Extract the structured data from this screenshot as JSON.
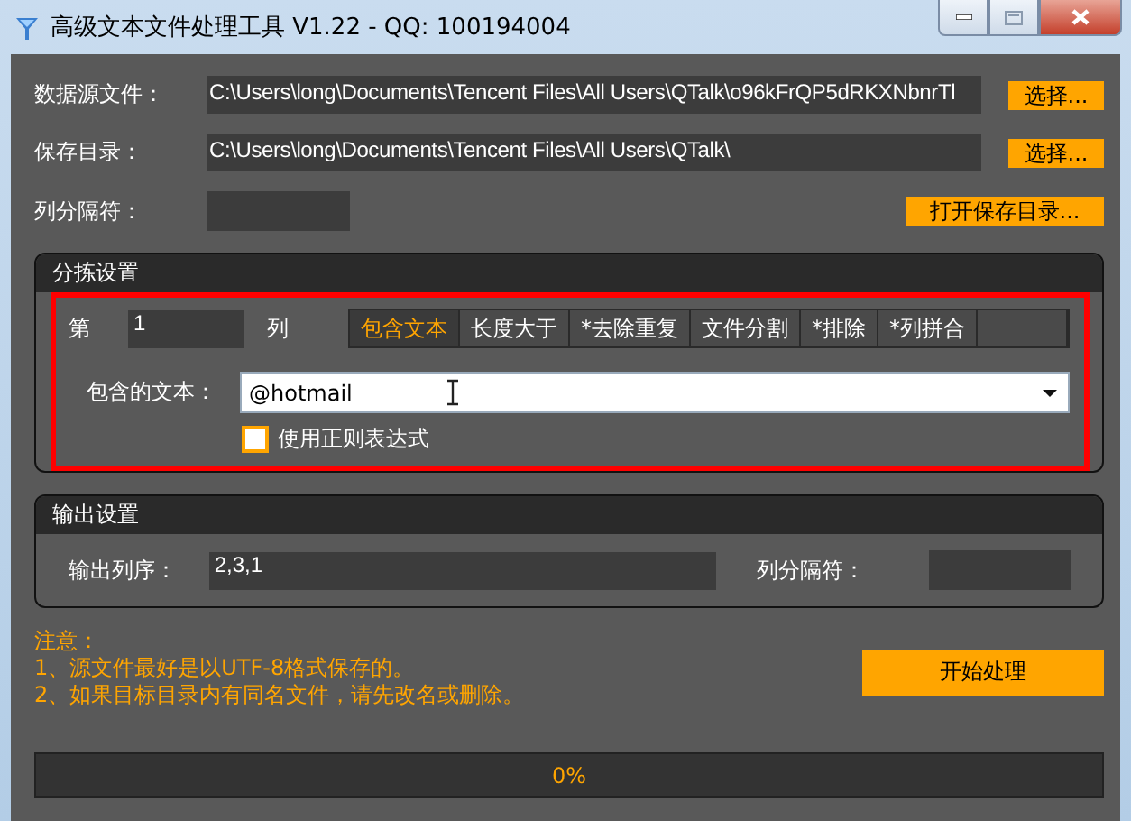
{
  "window": {
    "title": "高级文本文件处理工具 V1.22 - QQ: 100194004"
  },
  "source_file": {
    "label": "数据源文件：",
    "value": "C:\\Users\\long\\Documents\\Tencent Files\\All Users\\QTalk\\o96kFrQP5dRKXNbnrTl",
    "button": "选择..."
  },
  "save_dir": {
    "label": "保存目录：",
    "value": "C:\\Users\\long\\Documents\\Tencent Files\\All Users\\QTalk\\",
    "button": "选择..."
  },
  "separator": {
    "label": "列分隔符：",
    "button": "打开保存目录..."
  },
  "sort_group": {
    "title": "分拣设置",
    "highlighted": true,
    "column_prefix": "第",
    "column_value": "1",
    "column_suffix": "列",
    "tabs": [
      {
        "label": "包含文本",
        "selected": true
      },
      {
        "label": "长度大于",
        "selected": false
      },
      {
        "label": "*去除重复",
        "selected": false
      },
      {
        "label": "文件分割",
        "selected": false
      },
      {
        "label": "*排除",
        "selected": false
      },
      {
        "label": "*列拼合",
        "selected": false
      },
      {
        "selected": false
      }
    ],
    "contains_label": "包含的文本：",
    "contains_value": "@hotmail",
    "regex": {
      "label": "使用正则表达式",
      "checked": false
    }
  },
  "output_group": {
    "title": "输出设置",
    "order_label": "输出列序：",
    "order_value": "2,3,1",
    "separator_label": "列分隔符："
  },
  "notes": [
    "注意：",
    "1、源文件最好是以UTF-8格式保存的。",
    "2、如果目标目录内有同名文件，请先改名或删除。"
  ],
  "start_button": "开始处理",
  "progress": {
    "reading": "0%"
  }
}
